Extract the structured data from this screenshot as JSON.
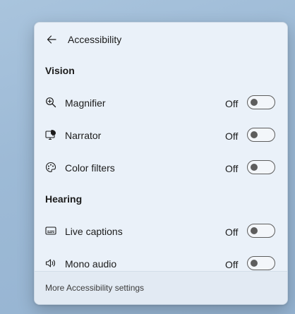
{
  "panel": {
    "title": "Accessibility",
    "back_icon": "arrow-left-icon"
  },
  "sections": [
    {
      "heading": "Vision",
      "items": [
        {
          "label": "Magnifier",
          "icon": "magnifier-icon",
          "state": "Off",
          "enabled": false
        },
        {
          "label": "Narrator",
          "icon": "narrator-icon",
          "state": "Off",
          "enabled": false
        },
        {
          "label": "Color filters",
          "icon": "color-palette-icon",
          "state": "Off",
          "enabled": false
        }
      ]
    },
    {
      "heading": "Hearing",
      "items": [
        {
          "label": "Live captions",
          "icon": "captions-icon",
          "state": "Off",
          "enabled": false
        },
        {
          "label": "Mono audio",
          "icon": "speaker-icon",
          "state": "Off",
          "enabled": false
        }
      ]
    }
  ],
  "footer": {
    "link": "More Accessibility settings"
  },
  "colors": {
    "background": "#9dbad6",
    "panel": "#eaf1f9",
    "footer": "#e2eaf3",
    "toggle_off": "#5d5d5d"
  }
}
